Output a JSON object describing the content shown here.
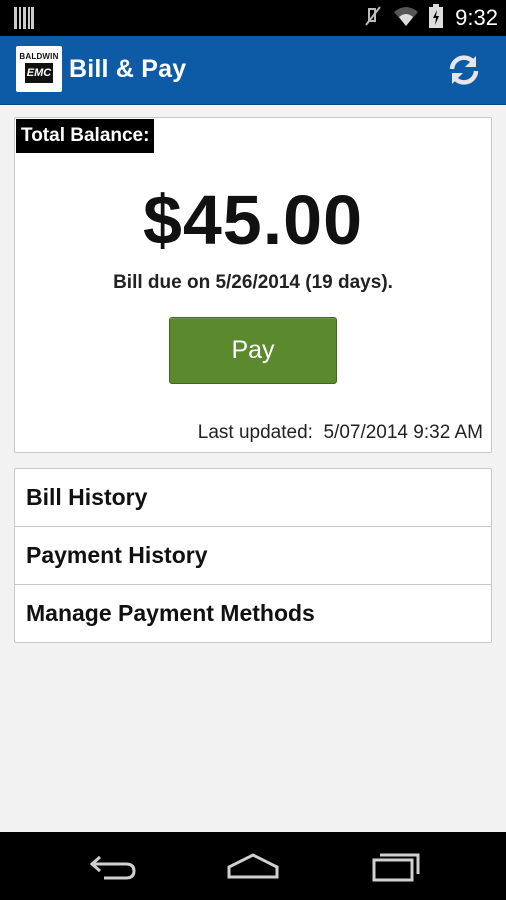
{
  "status_bar": {
    "time": "9:32",
    "icons": [
      "barcode-icon",
      "mute-icon",
      "wifi-icon",
      "battery-icon"
    ]
  },
  "action_bar": {
    "logo": {
      "top_text": "BALDWIN",
      "box_text": "EMC"
    },
    "title": "Bill & Pay",
    "refresh_icon": "refresh-icon"
  },
  "balance_card": {
    "label": "Total Balance:",
    "amount": "$45.00",
    "due_text": "Bill due on 5/26/2014 (19 days).",
    "pay_label": "Pay",
    "last_updated": "Last updated:  5/07/2014 9:32 AM"
  },
  "menu": {
    "items": [
      {
        "label": "Bill History"
      },
      {
        "label": "Payment History"
      },
      {
        "label": "Manage Payment Methods"
      }
    ]
  },
  "nav_bar": {
    "icons": [
      "back-icon",
      "home-icon",
      "recent-apps-icon"
    ]
  },
  "colors": {
    "action_bar": "#0d5aa7",
    "pay_button": "#5b8a2e",
    "background": "#f2f2f2"
  }
}
